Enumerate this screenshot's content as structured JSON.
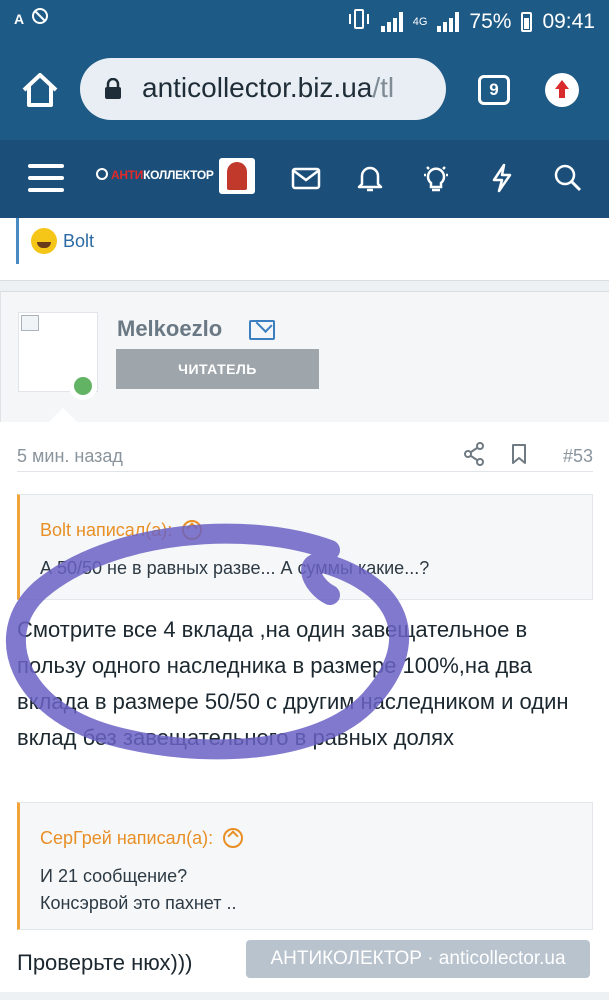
{
  "status_bar": {
    "battery": "75%",
    "time": "09:41",
    "network": "4G"
  },
  "browser": {
    "url_main": "anticollector.biz.ua",
    "url_rest": "/tl",
    "tab_count": "9"
  },
  "site": {
    "logo_prefix": "АНТИ",
    "logo_rest": "КОЛЛЕКТОР"
  },
  "previous_post": {
    "reaction_user": "Bolt"
  },
  "post": {
    "username": "Melkoezlo",
    "role": "ЧИТАТЕЛЬ",
    "time": "5 мин. назад",
    "number": "#53",
    "quote1": {
      "author": "Bolt написал(а):",
      "text": "А 50/50 не в равных разве... А суммы какие...?"
    },
    "body": "Смотрите все 4 вклада ,на один завещательное в пользу одного наследника в размере 100%,на два вклада в размере 50/50 с другим наследником и один вклад без завещательного в равных долях",
    "quote2": {
      "author": "СерГрей написал(а):",
      "line1": "И 21 сообщение?",
      "line2": "Консэрвой это пахнет .."
    },
    "body2": "Проверьте нюх)))"
  },
  "watermark": "АНТИКОЛЕКТОР · anticollector.ua",
  "colors": {
    "header": "#1e5a86",
    "nav": "#1b4f7a",
    "quote_accent": "#e88f25",
    "link": "#2a6aa5",
    "scribble": "#6a62c4"
  }
}
